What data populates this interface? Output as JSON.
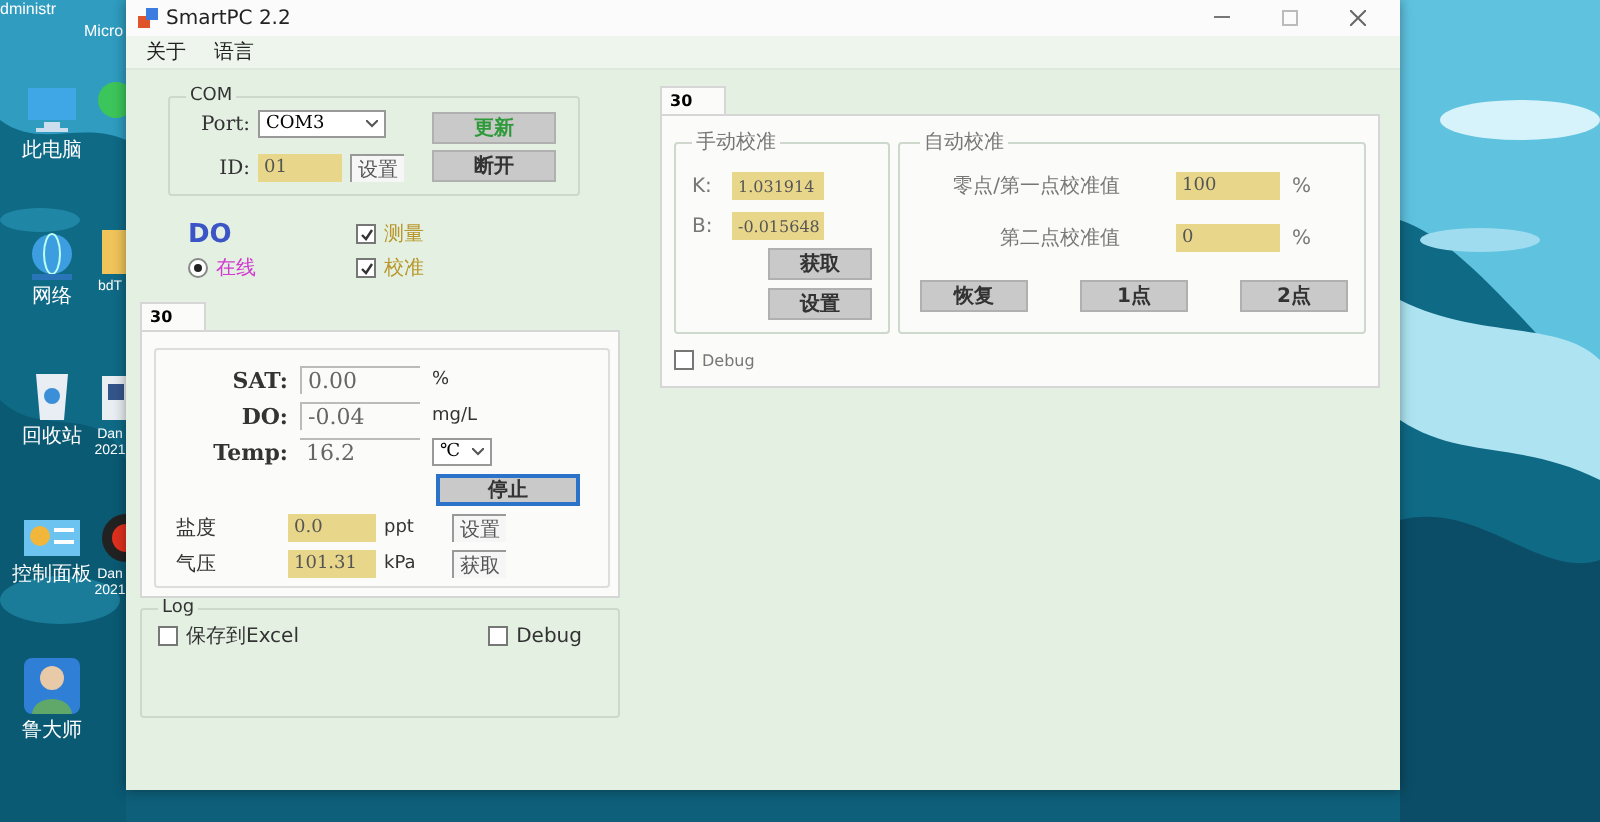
{
  "desktop": {
    "top_texts": [
      "dministr",
      "Micro"
    ],
    "icons": [
      {
        "kind": "computer",
        "label": "此电脑"
      },
      {
        "kind": "globe",
        "label": "网络"
      },
      {
        "kind": "bin",
        "label": "回收站"
      },
      {
        "kind": "panel",
        "label": "控制面板"
      },
      {
        "kind": "person",
        "label": "鲁大师"
      },
      {
        "kind": "chat"
      },
      {
        "kind": "folder",
        "label": "bdT"
      },
      {
        "kind": "file",
        "label": "Dan 2021"
      },
      {
        "kind": "record",
        "label": "Dan 2021"
      }
    ]
  },
  "window": {
    "title": "SmartPC 2.2"
  },
  "menu": [
    {
      "label": "关于"
    },
    {
      "label": "语言"
    }
  ],
  "com": {
    "legend": "COM",
    "port_label": "Port:",
    "port_value": "COM3",
    "id_label": "ID:",
    "id_value": "01",
    "set_button": "设置",
    "update_button": "更新",
    "disconnect_button": "断开"
  },
  "device": {
    "title": "DO",
    "online": {
      "label": "在线",
      "selected": true
    },
    "options": [
      {
        "label": "测量",
        "checked": true
      },
      {
        "label": "校准",
        "checked": true
      }
    ]
  },
  "left_tab": {
    "tabs": [
      {
        "label": "30",
        "selected": true
      }
    ],
    "readings": [
      {
        "label": "SAT:",
        "value": "0.00",
        "unit": "%"
      },
      {
        "label": "DO:",
        "value": "-0.04",
        "unit": "mg/L"
      }
    ],
    "temp": {
      "label": "Temp:",
      "value": "16.2",
      "unit": "℃"
    },
    "stop_button": "停止",
    "params": [
      {
        "label": "盐度",
        "value": "0.0",
        "unit": "ppt",
        "button": "设置"
      },
      {
        "label": "气压",
        "value": "101.31",
        "unit": "kPa",
        "button": "获取"
      }
    ]
  },
  "log": {
    "legend": "Log",
    "options": [
      {
        "label": "保存到Excel",
        "checked": false
      },
      {
        "label": "Debug",
        "checked": false
      }
    ]
  },
  "right_tab": {
    "tabs": [
      {
        "label": "30",
        "selected": true
      }
    ],
    "manual": {
      "legend": "手动校准",
      "fields": [
        {
          "label": "K:",
          "value": "1.031914"
        },
        {
          "label": "B:",
          "value": "-0.015648"
        }
      ],
      "buttons": [
        "获取",
        "设置"
      ]
    },
    "auto": {
      "legend": "自动校准",
      "fields": [
        {
          "label": "零点/第一点校准值",
          "value": "100",
          "unit": "%"
        },
        {
          "label": "第二点校准值",
          "value": "0",
          "unit": "%"
        }
      ],
      "buttons": [
        "恢复",
        "1点",
        "2点"
      ]
    },
    "debug": {
      "label": "Debug",
      "checked": false
    }
  }
}
